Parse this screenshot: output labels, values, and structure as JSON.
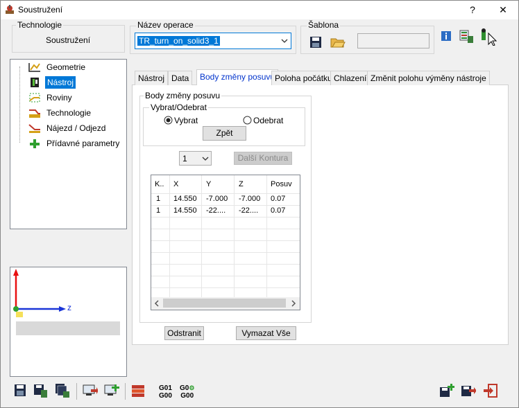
{
  "window": {
    "title": "Soustružení",
    "help": "?",
    "close": "✕"
  },
  "technology": {
    "label": "Technologie",
    "value": "Soustružení"
  },
  "operation": {
    "label": "Název operace",
    "value": "TR_turn_on_solid3_1"
  },
  "template": {
    "label": "Šablona",
    "value": ""
  },
  "tree": {
    "items": [
      {
        "label": "Geometrie",
        "icon": "geometry-icon",
        "selected": false
      },
      {
        "label": "Nástroj",
        "icon": "tool-icon",
        "selected": true
      },
      {
        "label": "Roviny",
        "icon": "planes-icon",
        "selected": false
      },
      {
        "label": "Technologie",
        "icon": "technology-icon",
        "selected": false
      },
      {
        "label": "Nájezd / Odjezd",
        "icon": "approach-icon",
        "selected": false
      },
      {
        "label": "Přídavné parametry",
        "icon": "add-params-icon",
        "selected": false
      }
    ]
  },
  "preview": {
    "axis_label": "z"
  },
  "tabs": [
    {
      "label": "Nástroj",
      "active": false
    },
    {
      "label": "Data",
      "active": false
    },
    {
      "label": "Body změny posuvu",
      "active": true
    },
    {
      "label": "Poloha počátku",
      "active": false
    },
    {
      "label": "Chlazení",
      "active": false
    },
    {
      "label": "Změnit polohu výměny nástroje",
      "active": false
    }
  ],
  "panel": {
    "group_title": "Body změny posuvu",
    "select_group": "Vybrat/Odebrat",
    "radio_select": "Vybrat",
    "radio_remove": "Odebrat",
    "back_button": "Zpět",
    "contour_value": "1",
    "next_contour_button": "Další Kontura",
    "remove_button": "Odstranit",
    "clear_all_button": "Vymazat Vše"
  },
  "grid": {
    "columns": [
      "K..",
      "X",
      "Y",
      "Z",
      "Posuv"
    ],
    "rows": [
      [
        "1",
        "14.550",
        "-7.000",
        "-7.000",
        "0.07"
      ],
      [
        "1",
        "14.550",
        "-22....",
        "-22....",
        "0.07"
      ]
    ]
  },
  "toolbar": {
    "gcode_g01": "G01",
    "gcode_g00a": "G00",
    "gcode_g0": "G0",
    "gcode_g00b": "G00"
  },
  "colors": {
    "accent": "#0078d7",
    "selection": "#0078d7",
    "axis_red": "#e81010",
    "axis_blue": "#1a35d8"
  }
}
